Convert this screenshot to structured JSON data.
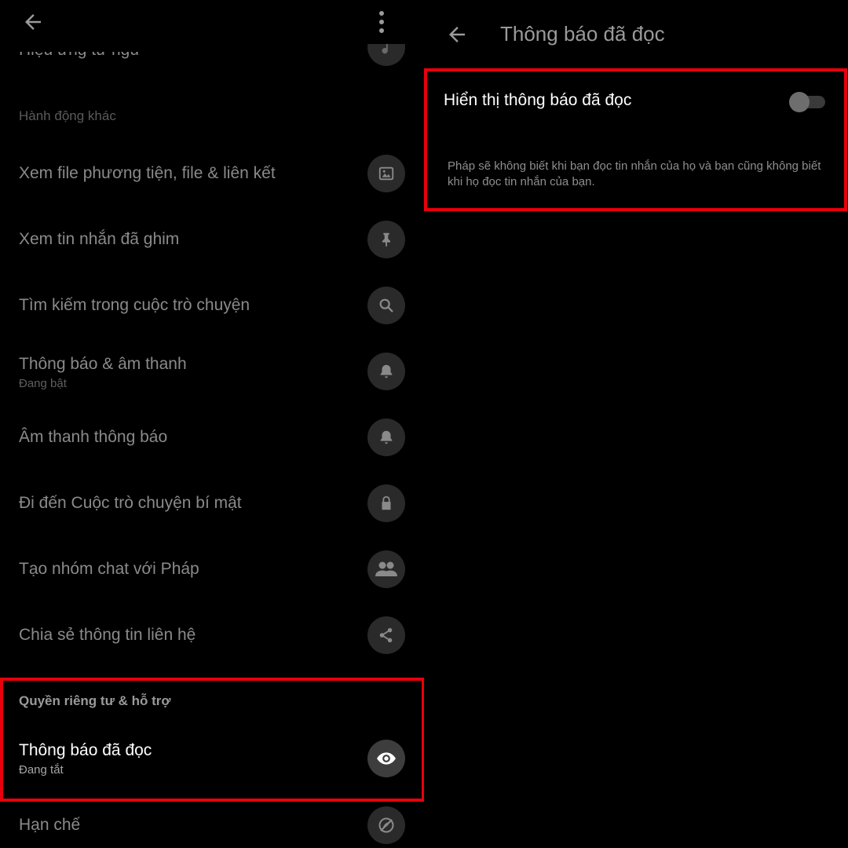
{
  "left_panel": {
    "partial_item_label": "Hiệu ứng từ ngữ",
    "section_other": "Hành động khác",
    "items": [
      {
        "label": "Xem file phương tiện, file & liên kết",
        "icon": "image-icon"
      },
      {
        "label": "Xem tin nhắn đã ghim",
        "icon": "pin-icon"
      },
      {
        "label": "Tìm kiếm trong cuộc trò chuyện",
        "icon": "search-icon"
      },
      {
        "label": "Thông báo & âm thanh",
        "sub": "Đang bật",
        "icon": "bell-icon"
      },
      {
        "label": "Âm thanh thông báo",
        "icon": "bell-icon"
      },
      {
        "label": "Đi đến Cuộc trò chuyện bí mật",
        "icon": "lock-icon"
      },
      {
        "label": "Tạo nhóm chat với Pháp",
        "icon": "group-icon"
      },
      {
        "label": "Chia sẻ thông tin liên hệ",
        "icon": "share-icon"
      }
    ],
    "section_privacy": "Quyền riêng tư & hỗ trợ",
    "read_receipts_item": {
      "label": "Thông báo đã đọc",
      "sub": "Đang tắt",
      "icon": "eye-icon"
    },
    "restrict_item": {
      "label": "Hạn chế",
      "icon": "restrict-icon"
    }
  },
  "right_panel": {
    "title": "Thông báo đã đọc",
    "toggle_label": "Hiển thị thông báo đã đọc",
    "toggle_state": "off",
    "description": "Pháp sẽ không biết khi bạn đọc tin nhắn của họ và bạn cũng không biết khi họ đọc tin nhắn của bạn."
  },
  "colors": {
    "highlight": "#e8000b",
    "background": "#000000",
    "icon_circle": "#2a2a2a"
  }
}
